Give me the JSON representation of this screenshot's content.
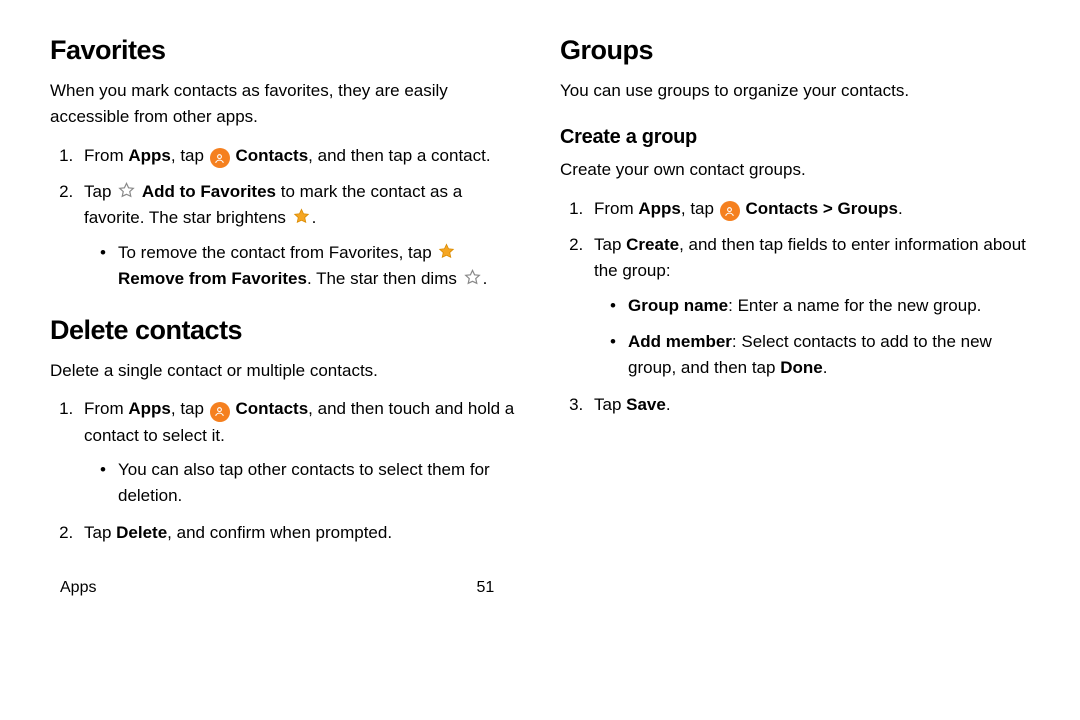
{
  "left": {
    "favorites": {
      "title": "Favorites",
      "intro": "When you mark contacts as favorites, they are easily accessible from other apps.",
      "step1_pre": "From ",
      "step1_apps": "Apps",
      "step1_mid": ", tap ",
      "step1_contacts": "Contacts",
      "step1_post": ", and then tap a contact.",
      "step2_pre": "Tap ",
      "step2_add": "Add to Favorites",
      "step2_mid": " to mark the contact as a favorite. The star brightens ",
      "step2_dot": ".",
      "sub_pre": "To remove the contact from Favorites, tap ",
      "sub_remove": "Remove from Favorites",
      "sub_mid": ". The star then dims ",
      "sub_dot": "."
    },
    "delete": {
      "title": "Delete contacts",
      "intro": "Delete a single contact or multiple contacts.",
      "step1_pre": "From ",
      "step1_apps": "Apps",
      "step1_mid": ", tap ",
      "step1_contacts": "Contacts",
      "step1_post": ", and then touch and hold a contact to select it.",
      "sub": "You can also tap other contacts to select them for deletion.",
      "step2_pre": "Tap ",
      "step2_delete": "Delete",
      "step2_post": ", and confirm when prompted."
    }
  },
  "right": {
    "groups": {
      "title": "Groups",
      "intro": "You can use groups to organize your contacts.",
      "create_title": "Create a group",
      "create_intro": "Create your own contact groups.",
      "step1_pre": "From ",
      "step1_apps": "Apps",
      "step1_mid": ", tap ",
      "step1_contacts": "Contacts",
      "step1_sep": " > ",
      "step1_groups": "Groups",
      "step1_dot": ".",
      "step2_pre": "Tap ",
      "step2_create": "Create",
      "step2_post": ", and then tap fields to enter information about the group:",
      "sub1_name": "Group name",
      "sub1_rest": ": Enter a name for the new group.",
      "sub2_name": "Add member",
      "sub2_mid": ": Select contacts to add to the new group, and then tap ",
      "sub2_done": "Done",
      "sub2_dot": ".",
      "step3_pre": "Tap ",
      "step3_save": "Save",
      "step3_dot": "."
    }
  },
  "footer": {
    "section": "Apps",
    "page": "51"
  }
}
